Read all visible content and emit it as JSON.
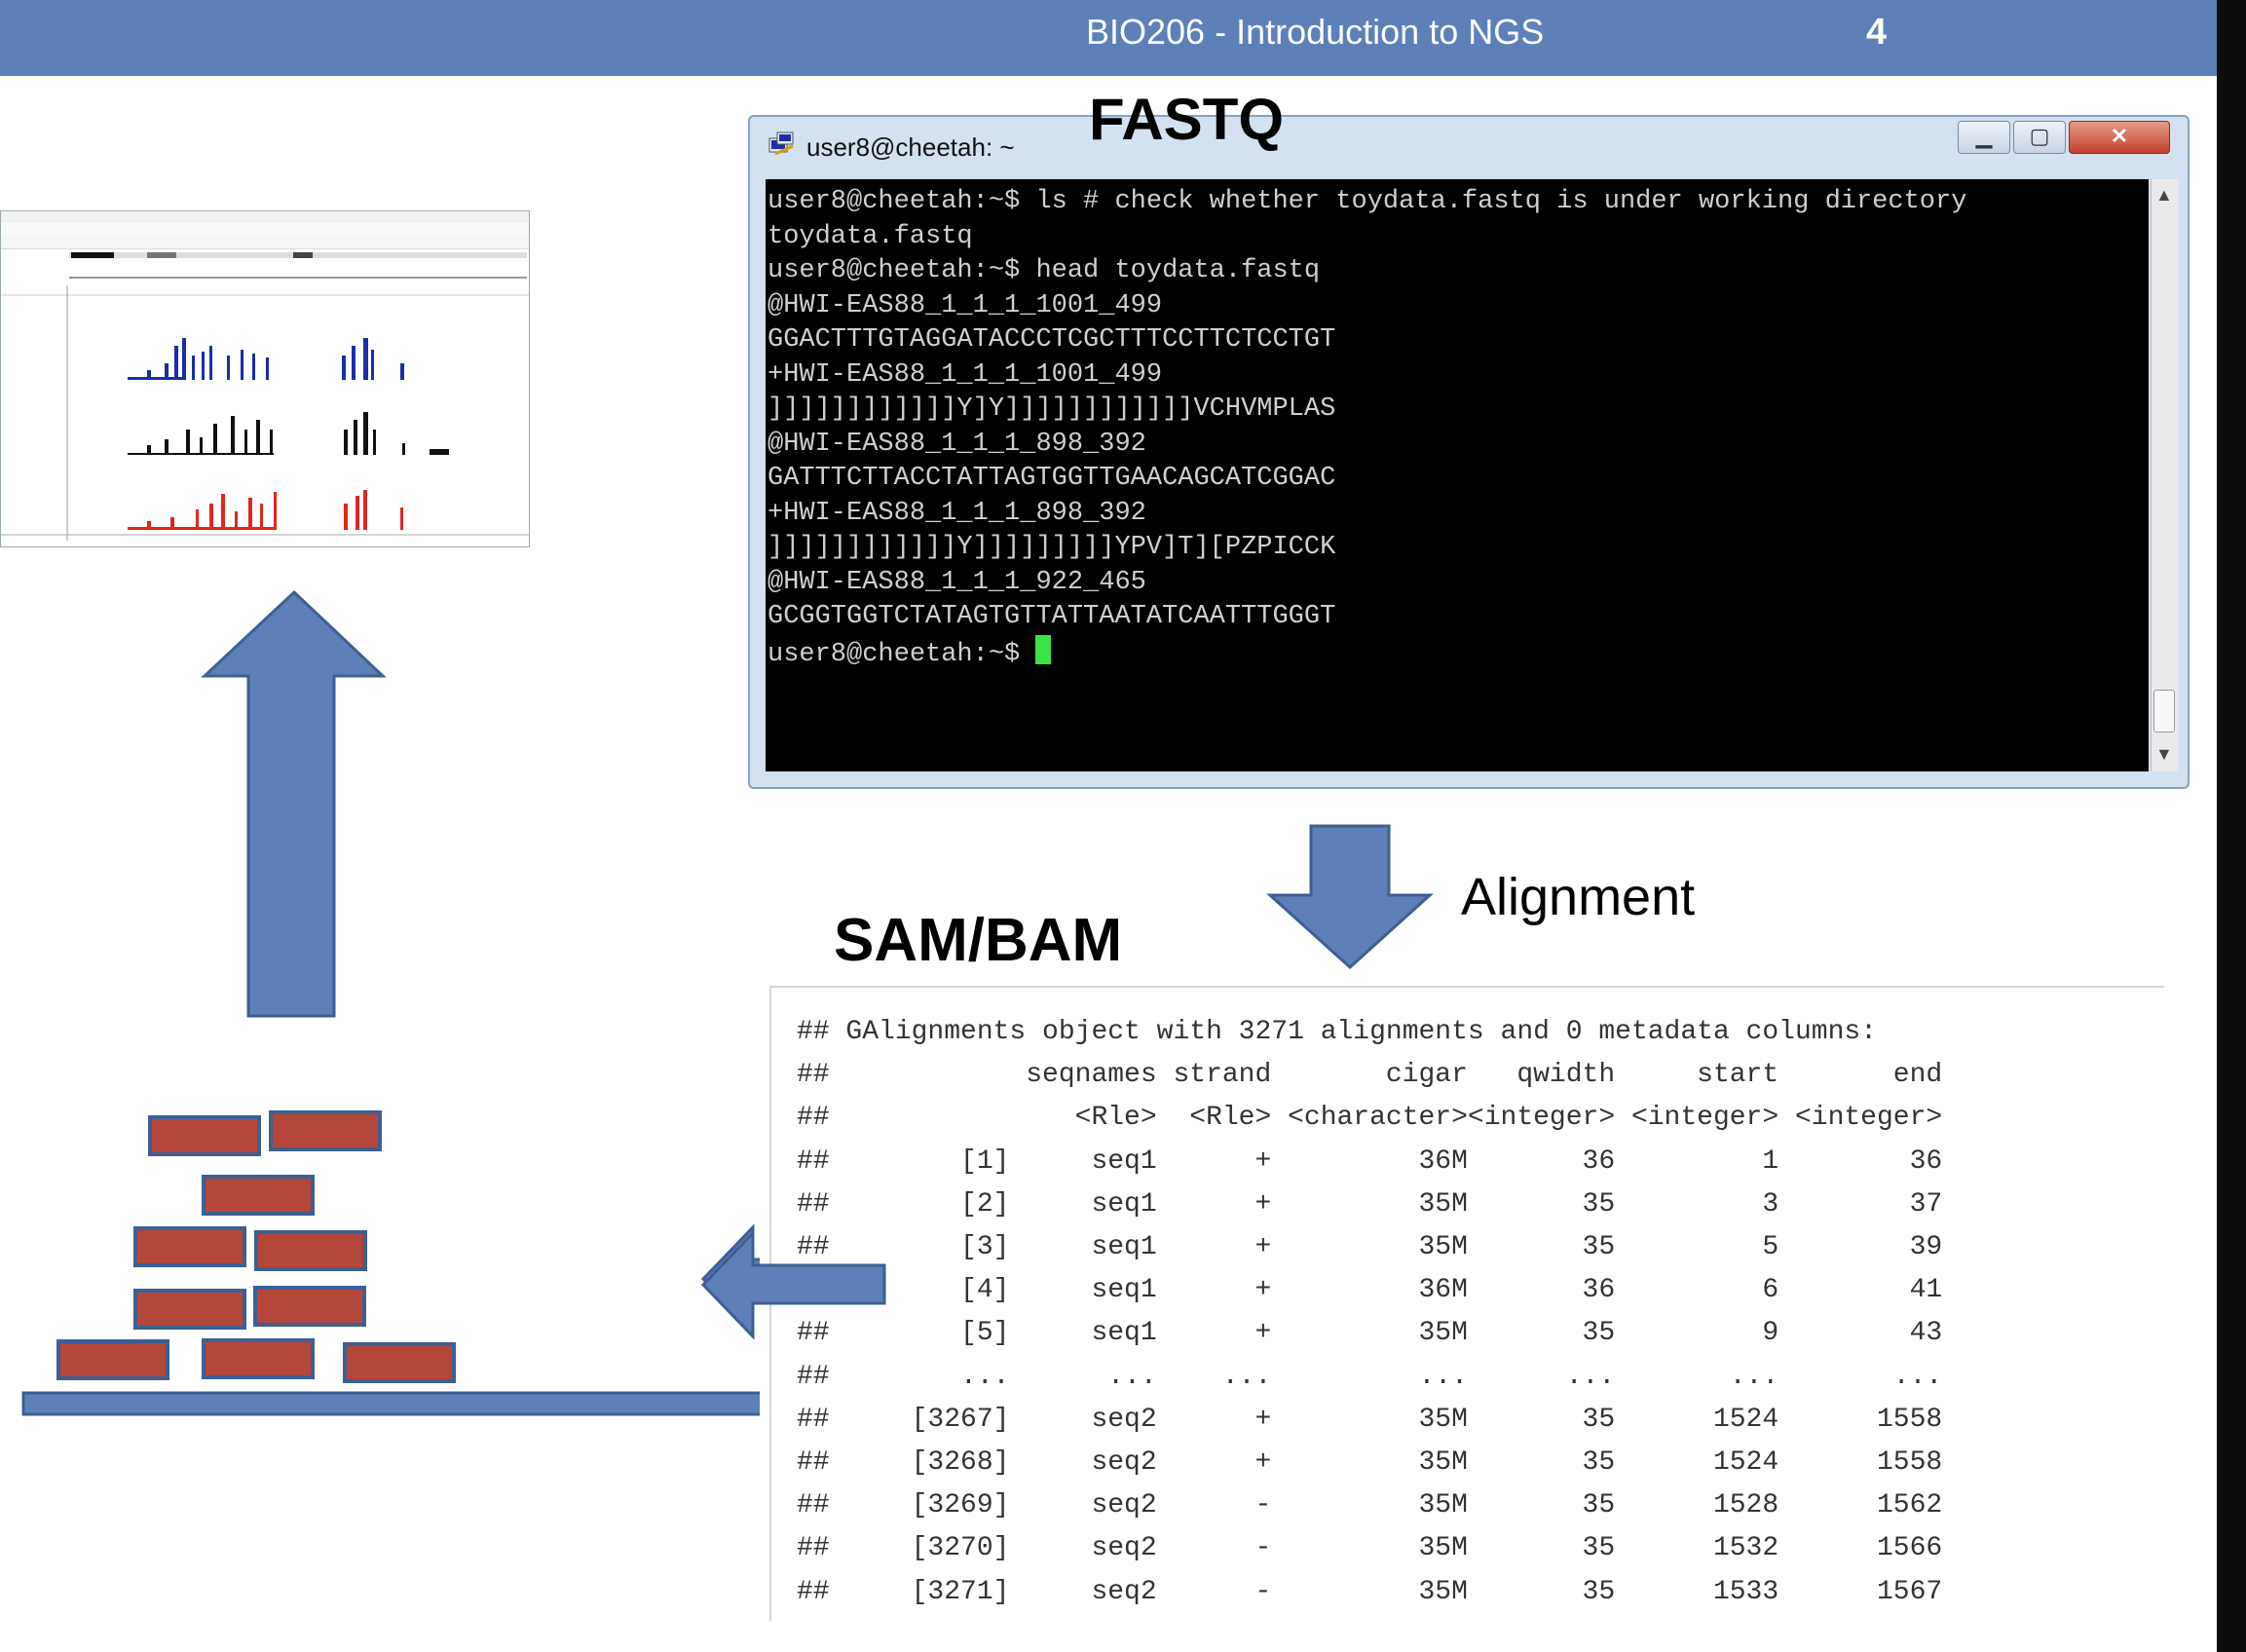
{
  "header": {
    "title": "BIO206 - Introduction to NGS",
    "page_number": "4",
    "color": "#5b81b8"
  },
  "fastq_label": "FASTQ",
  "terminal": {
    "title": "user8@cheetah: ~",
    "lines": [
      "user8@cheetah:~$ ls # check whether toydata.fastq is under working directory",
      "toydata.fastq",
      "user8@cheetah:~$ head toydata.fastq",
      "@HWI-EAS88_1_1_1_1001_499",
      "GGACTTTGTAGGATACCCTCGCTTTCCTTCTCCTGT",
      "+HWI-EAS88_1_1_1_1001_499",
      "]]]]]]]]]]]]Y]Y]]]]]]]]]]]]VCHVMPLAS",
      "@HWI-EAS88_1_1_1_898_392",
      "GATTTCTTACCTATTAGTGGTTGAACAGCATCGGAC",
      "+HWI-EAS88_1_1_1_898_392",
      "]]]]]]]]]]]]Y]]]]]]]]]YPV]T][PZPICCK",
      "@HWI-EAS88_1_1_1_922_465",
      "GCGGTGGTCTATAGTGTTATTAATATCAATTTGGGT"
    ],
    "prompt": "user8@cheetah:~$ ",
    "cursor_color": "#3be34a"
  },
  "alignment_label": "Alignment",
  "sambam_label": "SAM/BAM",
  "sam_output": {
    "summary": "## GAlignments object with 3271 alignments and 0 metadata columns:",
    "headers": [
      "seqnames",
      "strand",
      "cigar",
      "qwidth",
      "start",
      "end"
    ],
    "types": [
      "<Rle>",
      "<Rle>",
      "<character>",
      "<integer>",
      "<integer>",
      "<integer>"
    ],
    "rows": [
      [
        "[1]",
        "seq1",
        "+",
        "36M",
        "36",
        "1",
        "36"
      ],
      [
        "[2]",
        "seq1",
        "+",
        "35M",
        "35",
        "3",
        "37"
      ],
      [
        "[3]",
        "seq1",
        "+",
        "35M",
        "35",
        "5",
        "39"
      ],
      [
        "[4]",
        "seq1",
        "+",
        "36M",
        "36",
        "6",
        "41"
      ],
      [
        "[5]",
        "seq1",
        "+",
        "35M",
        "35",
        "9",
        "43"
      ],
      [
        "...",
        "...",
        "...",
        "...",
        "...",
        "...",
        "..."
      ],
      [
        "[3267]",
        "seq2",
        "+",
        "35M",
        "35",
        "1524",
        "1558"
      ],
      [
        "[3268]",
        "seq2",
        "+",
        "35M",
        "35",
        "1524",
        "1558"
      ],
      [
        "[3269]",
        "seq2",
        "-",
        "35M",
        "35",
        "1528",
        "1562"
      ],
      [
        "[3270]",
        "seq2",
        "-",
        "35M",
        "35",
        "1532",
        "1566"
      ],
      [
        "[3271]",
        "seq2",
        "-",
        "35M",
        "35",
        "1533",
        "1567"
      ]
    ]
  },
  "colors": {
    "arrow": "#5b81b8",
    "brick": "#b5473a",
    "track_blue": "#1a2ea8",
    "track_black": "#111111",
    "track_red": "#e2261d"
  }
}
